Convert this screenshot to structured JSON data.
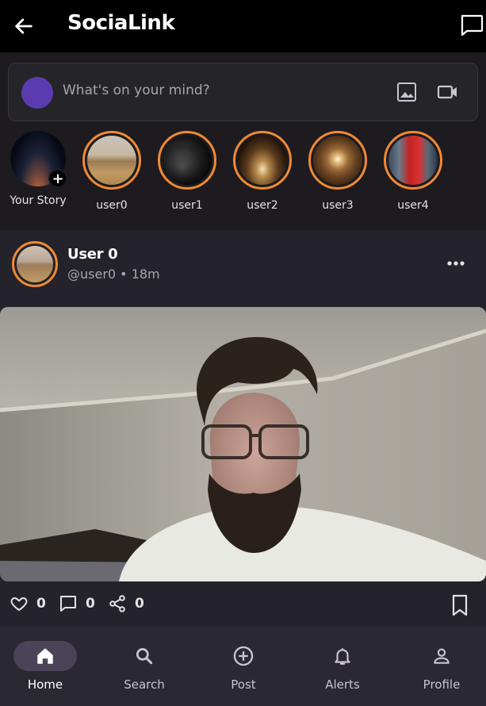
{
  "header": {
    "title": "SociaLink"
  },
  "composer": {
    "placeholder": "What's on your mind?"
  },
  "stories": {
    "own_label": "Your Story",
    "items": [
      {
        "label": "user0"
      },
      {
        "label": "user1"
      },
      {
        "label": "user2"
      },
      {
        "label": "user3"
      },
      {
        "label": "user4"
      }
    ]
  },
  "post": {
    "name": "User 0",
    "meta": "@user0 • 18m",
    "likes": "0",
    "comments": "0",
    "shares": "0"
  },
  "nav": {
    "items": [
      {
        "label": "Home",
        "icon": "home-icon"
      },
      {
        "label": "Search",
        "icon": "search-icon"
      },
      {
        "label": "Post",
        "icon": "add-circle-icon"
      },
      {
        "label": "Alerts",
        "icon": "bell-icon"
      },
      {
        "label": "Profile",
        "icon": "person-icon"
      }
    ],
    "active": "Home"
  },
  "colors": {
    "accent_ring": "#f08a33",
    "avatar": "#5b3cb0",
    "nav_active": "#4a4458"
  }
}
